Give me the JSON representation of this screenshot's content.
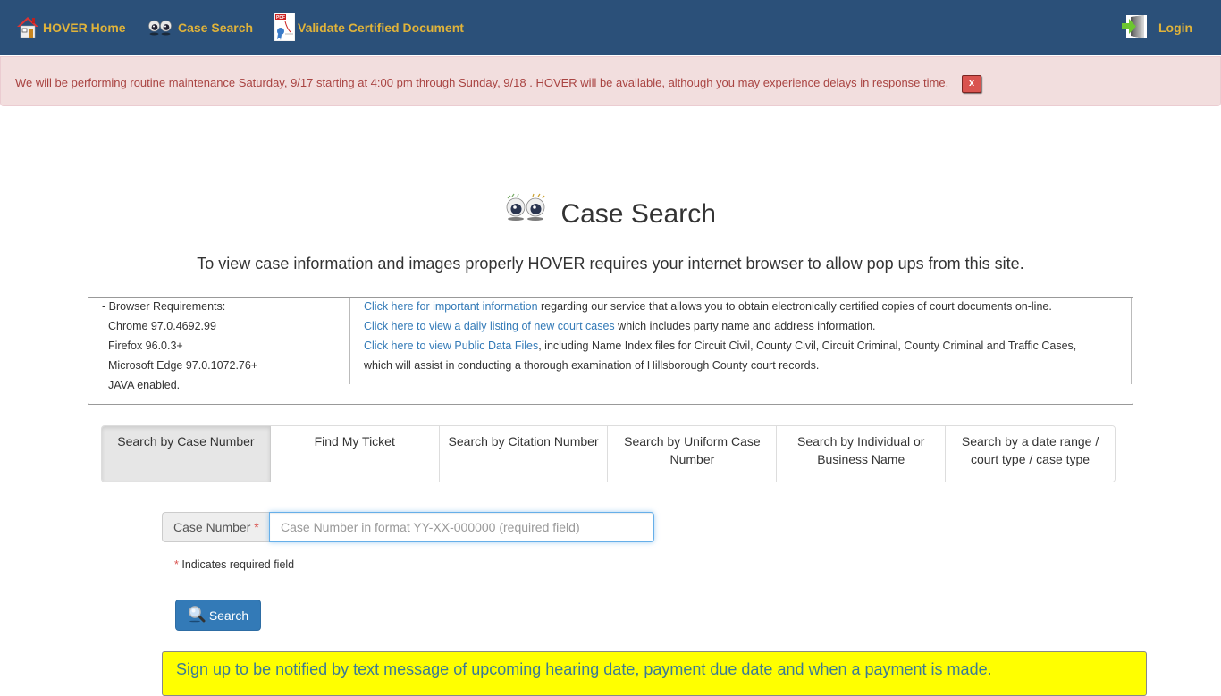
{
  "navbar": {
    "home_label": "HOVER Home",
    "case_search_label": "Case Search",
    "validate_label": "Validate Certified Document",
    "login_label": "Login",
    "colors": {
      "background": "#2b5079",
      "link": "#e0b33a"
    }
  },
  "alert": {
    "message": "We will be performing routine maintenance Saturday, 9/17 starting at 4:00 pm through Sunday, 9/18 . HOVER will be available, although you may experience delays in response time.",
    "close_label": "x"
  },
  "page": {
    "title": "Case Search",
    "subtitle": "To view case information and images properly HOVER requires your internet browser to allow pop ups from this site."
  },
  "info_box": {
    "requirements": [
      "- Browser Requirements:",
      "Chrome 97.0.4692.99",
      "Firefox 96.0.3+",
      "Microsoft Edge 97.0.1072.76+",
      "JAVA enabled."
    ],
    "links": [
      {
        "link_text": "Click here for important information",
        "rest": " regarding our service that allows you to obtain electronically certified copies of court documents on-line."
      },
      {
        "link_text": "Click here to view a daily listing of new court cases",
        "rest": " which includes party name and address information."
      },
      {
        "link_text": "Click here to view Public Data Files",
        "rest": ", including Name Index files for Circuit Civil, County Civil, Circuit Criminal, County Criminal and Traffic Cases,"
      }
    ],
    "continuation": "which will assist in conducting a thorough examination of Hillsborough County court records."
  },
  "tabs": [
    {
      "label": "Search by Case Number",
      "active": true
    },
    {
      "label": "Find My Ticket",
      "active": false
    },
    {
      "label": "Search by Citation Number",
      "active": false
    },
    {
      "label": "Search by Uniform Case Number",
      "active": false
    },
    {
      "label": "Search by Individual or Business Name",
      "active": false
    },
    {
      "label": "Search by a date range / court type / case type",
      "active": false
    }
  ],
  "form": {
    "case_number_label": "Case Number",
    "required_marker": "*",
    "case_number_value": "",
    "case_number_placeholder": "Case Number in format YY-XX-000000 (required field)",
    "required_note": "Indicates required field",
    "search_button": "Search"
  },
  "notify_banner": {
    "text": "Sign up to be notified by text message of upcoming hearing date, payment due date and when a payment is made."
  }
}
